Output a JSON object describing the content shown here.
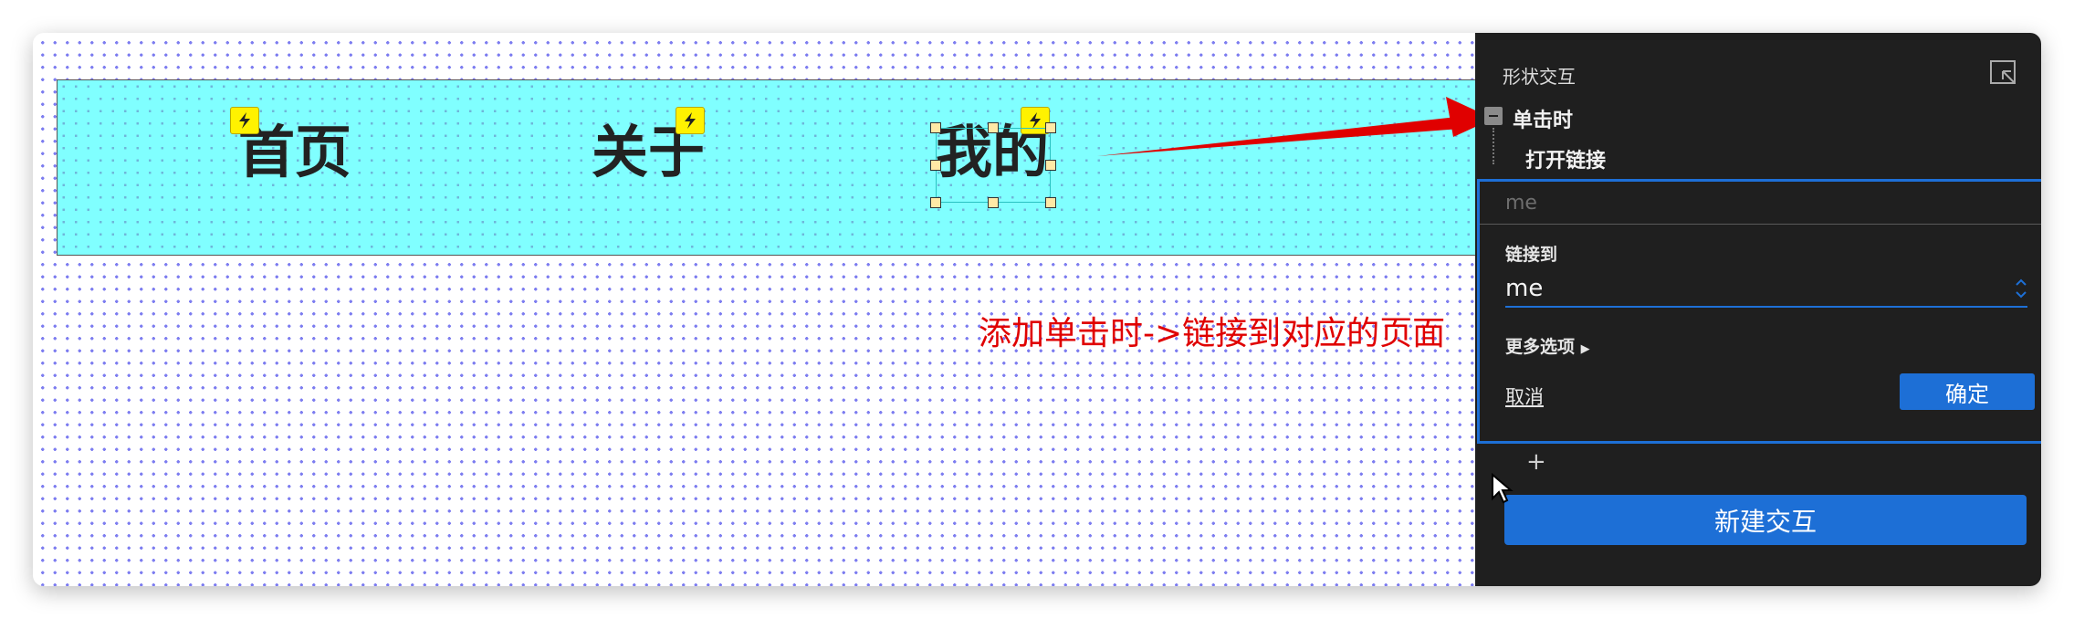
{
  "navbar": {
    "items": [
      {
        "label": "首页"
      },
      {
        "label": "关于"
      },
      {
        "label": "我的"
      }
    ]
  },
  "annotation": {
    "text": "添加单击时->链接到对应的页面",
    "color": "#e00000"
  },
  "panel": {
    "title": "形状交互",
    "event": "单击时",
    "action": "打开链接",
    "target_placeholder": "me",
    "link_to_label": "链接到",
    "link_to_value": "me",
    "more_options": "更多选项",
    "cancel": "取消",
    "confirm": "确定",
    "add": "+",
    "new_interaction": "新建交互"
  },
  "colors": {
    "navbar_bg": "#80ffff",
    "panel_bg": "#1f1f1f",
    "accent": "#1d6fd6",
    "interaction_badge": "#fff200"
  }
}
